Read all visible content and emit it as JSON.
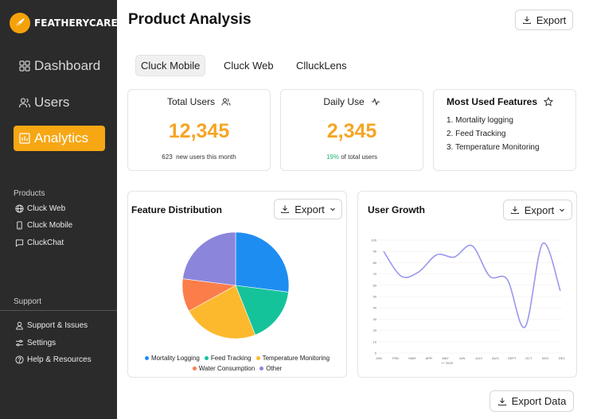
{
  "brand": {
    "name": "FEATHERYCARE",
    "accent": "#f5a20a"
  },
  "sidebar": {
    "nav": [
      {
        "label": "Dashboard",
        "icon": "grid-icon"
      },
      {
        "label": "Users",
        "icon": "users-icon"
      },
      {
        "label": "Analytics",
        "icon": "bar-chart-icon",
        "active": true
      }
    ],
    "products_label": "Products",
    "products": [
      {
        "label": "Cluck Web",
        "icon": "globe-icon"
      },
      {
        "label": "Cluck Mobile",
        "icon": "smartphone-icon"
      },
      {
        "label": "CluckChat",
        "icon": "chat-icon"
      }
    ],
    "support_label": "Support",
    "support": [
      {
        "label": "Support & Issues",
        "icon": "support-icon"
      },
      {
        "label": "Settings",
        "icon": "sliders-icon"
      },
      {
        "label": "Help & Resources",
        "icon": "help-icon"
      }
    ]
  },
  "header": {
    "title": "Product Analysis",
    "export_label": "Export"
  },
  "tabs": [
    {
      "label": "Cluck Mobile",
      "active": true
    },
    {
      "label": "Cluck Web"
    },
    {
      "label": "ClluckLens"
    }
  ],
  "stats": {
    "total_users": {
      "title": "Total Users",
      "value": "12,345",
      "sub_count": "623",
      "sub_text": "new users this month"
    },
    "daily_use": {
      "title": "Daily Use",
      "value": "2,345",
      "sub_pct": "19%",
      "sub_text": "of total users"
    }
  },
  "most_used": {
    "title": "Most Used Features",
    "items": [
      "1. Mortality logging",
      "2. Feed Tracking",
      "3. Temperature Monitoring"
    ]
  },
  "feature_distribution": {
    "title": "Feature Distribution",
    "export_label": "Export"
  },
  "user_growth": {
    "title": "User Growth",
    "export_label": "Export",
    "x_caption": "++ 2025"
  },
  "footer": {
    "export_data_label": "Export Data"
  },
  "chart_data": [
    {
      "type": "pie",
      "title": "Feature Distribution",
      "categories": [
        "Mortality Logging",
        "Feed Tracking",
        "Temperature Monitoring",
        "Water Consumption",
        "Other"
      ],
      "values": [
        27,
        17,
        23,
        10,
        23
      ],
      "colors": [
        "#1e8df2",
        "#15c39b",
        "#fdb92e",
        "#fb7d4a",
        "#8b86db"
      ],
      "legend": "bottom"
    },
    {
      "type": "line",
      "title": "User Growth",
      "x": [
        "JAN",
        "FEB",
        "MAR",
        "APR",
        "MAY",
        "JUN",
        "JULY",
        "AUG",
        "SEPT",
        "OCT",
        "NOV",
        "DEC"
      ],
      "values": [
        90,
        68,
        72,
        87,
        85,
        95,
        68,
        65,
        23,
        97,
        55
      ],
      "ylim": [
        0,
        100
      ],
      "yticks": [
        0,
        10,
        20,
        30,
        40,
        50,
        60,
        70,
        80,
        90,
        100
      ],
      "color": "#9a98ee",
      "grid": true
    }
  ]
}
